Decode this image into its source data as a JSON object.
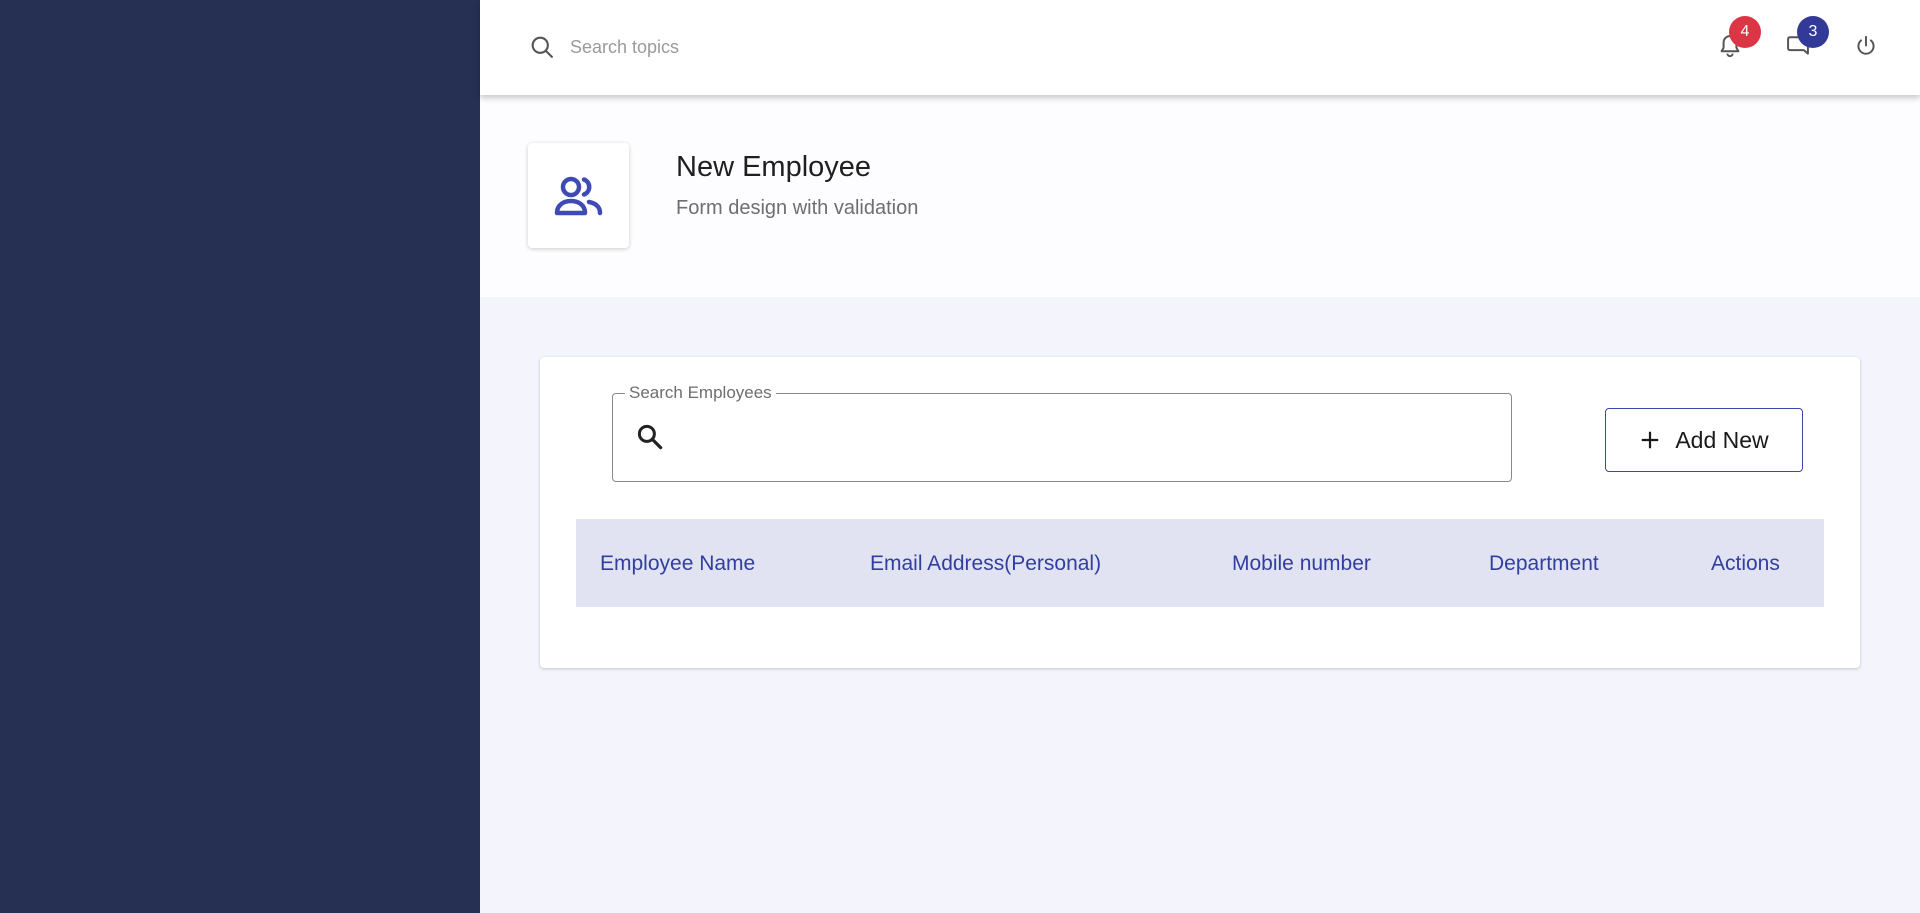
{
  "topbar": {
    "search_placeholder": "Search topics",
    "notifications": {
      "icon": "bell-icon",
      "count": "4",
      "badge_color": "#dc3545"
    },
    "messages": {
      "icon": "message-icon",
      "count": "3",
      "badge_color": "#333996"
    },
    "power": {
      "icon": "power-icon"
    }
  },
  "header": {
    "icon": "people-icon",
    "title": "New Employee",
    "subtitle": "Form design with validation"
  },
  "employee_search": {
    "label": "Search Employees",
    "value": "",
    "icon": "search-icon"
  },
  "add_button": {
    "icon": "plus-icon",
    "label": "Add New"
  },
  "table": {
    "columns": [
      "Employee Name",
      "Email Address(Personal)",
      "Mobile number",
      "Department",
      "Actions"
    ],
    "rows": []
  },
  "colors": {
    "sidebar": "#253053",
    "accent": "#333996",
    "background": "#f3f4fc"
  }
}
